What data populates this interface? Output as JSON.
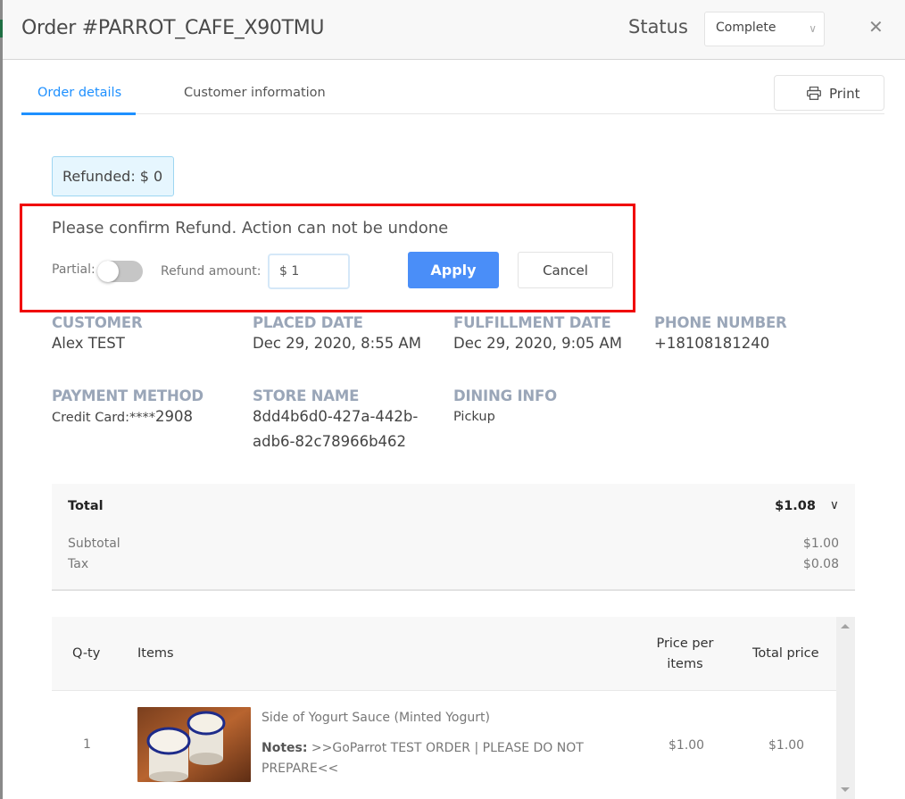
{
  "header": {
    "title": "Order #PARROT_CAFE_X90TMU",
    "status_label": "Status",
    "status_value": "Complete",
    "close_icon": "close-icon"
  },
  "tabs": [
    {
      "label": "Order details",
      "active": true
    },
    {
      "label": "Customer information",
      "active": false
    }
  ],
  "toolbar": {
    "print_label": "Print",
    "print_icon": "printer-icon"
  },
  "refund": {
    "badge": "Refunded: $ 0",
    "confirm_text": "Please confirm Refund. Action can not be undone",
    "partial_label": "Partial:",
    "partial_on": false,
    "amount_label": "Refund amount:",
    "amount_value": "$ 1",
    "apply_label": "Apply",
    "cancel_label": "Cancel",
    "highlight_color": "#f00000"
  },
  "info": {
    "customer": {
      "label": "CUSTOMER",
      "value": "Alex TEST"
    },
    "placed_date": {
      "label": "PLACED DATE",
      "value": "Dec 29, 2020, 8:55 AM"
    },
    "fulfillment_date": {
      "label": "FULFILLMENT DATE",
      "value": "Dec 29, 2020, 9:05 AM"
    },
    "phone": {
      "label": "PHONE NUMBER",
      "value": "+18108181240"
    },
    "payment": {
      "label": "PAYMENT METHOD",
      "prefix": "Credit Card:****",
      "last4": "2908"
    },
    "store": {
      "label": "STORE NAME",
      "line1": "8dd4b6d0-427a-442b-",
      "line2": "adb6-82c78966b462"
    },
    "dining": {
      "label": "DINING INFO",
      "value": "Pickup"
    }
  },
  "totals": {
    "total_label": "Total",
    "total_value": "$1.08",
    "rows": [
      {
        "label": "Subtotal",
        "value": "$1.00"
      },
      {
        "label": "Tax",
        "value": "$0.08"
      }
    ]
  },
  "items_table": {
    "headers": {
      "qty": "Q-ty",
      "items": "Items",
      "price_line1": "Price per",
      "price_line2": "items",
      "total": "Total price"
    },
    "rows": [
      {
        "qty": "1",
        "name": "Side of Yogurt Sauce (Minted Yogurt)",
        "notes_label": "Notes:",
        "notes_line1": ">>GoParrot TEST ORDER | PLEASE DO NOT",
        "notes_line2": "PREPARE<<",
        "price": "$1.00",
        "total": "$1.00",
        "image": "yogurt-cups-image"
      }
    ]
  },
  "colors": {
    "accent": "#1e90ff",
    "apply": "#4a8ef8",
    "label_gray": "#9aa6b8"
  }
}
